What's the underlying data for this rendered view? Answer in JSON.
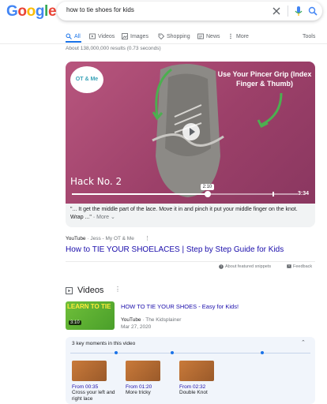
{
  "logo": {
    "letters": [
      {
        "ch": "G",
        "color": "#4285F4"
      },
      {
        "ch": "o",
        "color": "#EA4335"
      },
      {
        "ch": "o",
        "color": "#FBBC05"
      },
      {
        "ch": "g",
        "color": "#4285F4"
      },
      {
        "ch": "l",
        "color": "#34A853"
      },
      {
        "ch": "e",
        "color": "#EA4335"
      }
    ]
  },
  "search": {
    "query": "how to tie shoes for kids"
  },
  "tabs": {
    "all": "All",
    "videos": "Videos",
    "images": "Images",
    "shopping": "Shopping",
    "news": "News",
    "more": "More",
    "tools": "Tools"
  },
  "result_stats": "About 138,000,000 results (0.73 seconds)",
  "featured": {
    "brand": "OT & Me",
    "overlay_title": "Use Your Pincer Grip (Index Finger & Thumb)",
    "hack_label": "Hack No. 2",
    "current_time": "2:10",
    "duration": "3:34",
    "progress": 0.6,
    "caption": "\"... It get the middle part of the lace. Move it in and pinch it put your middle finger on the knot. Wrap ...\"",
    "caption_more": "More",
    "source_site": "YouTube",
    "source_author": "Jess - My OT & Me",
    "title": "How to TIE YOUR SHOELACES | Step by Step Guide for Kids",
    "about_snippets": "About featured snippets",
    "feedback": "Feedback"
  },
  "videos_section": {
    "heading": "Videos",
    "item": {
      "thumb_label": "LEARN TO TIE",
      "thumb_time": "3:10",
      "title": "HOW TO TIE YOUR SHOES - Easy for Kids!",
      "source_site": "YouTube",
      "source_author": "The Kidsplainer",
      "date": "Mar 27, 2020"
    },
    "key_moments": {
      "header": "3 key moments in this video",
      "items": [
        {
          "from": "From 00:35",
          "label": "Cross your left and right lace"
        },
        {
          "from": "From 01:20",
          "label": "More tricky"
        },
        {
          "from": "From 02:32",
          "label": "Double Knot"
        }
      ]
    }
  }
}
